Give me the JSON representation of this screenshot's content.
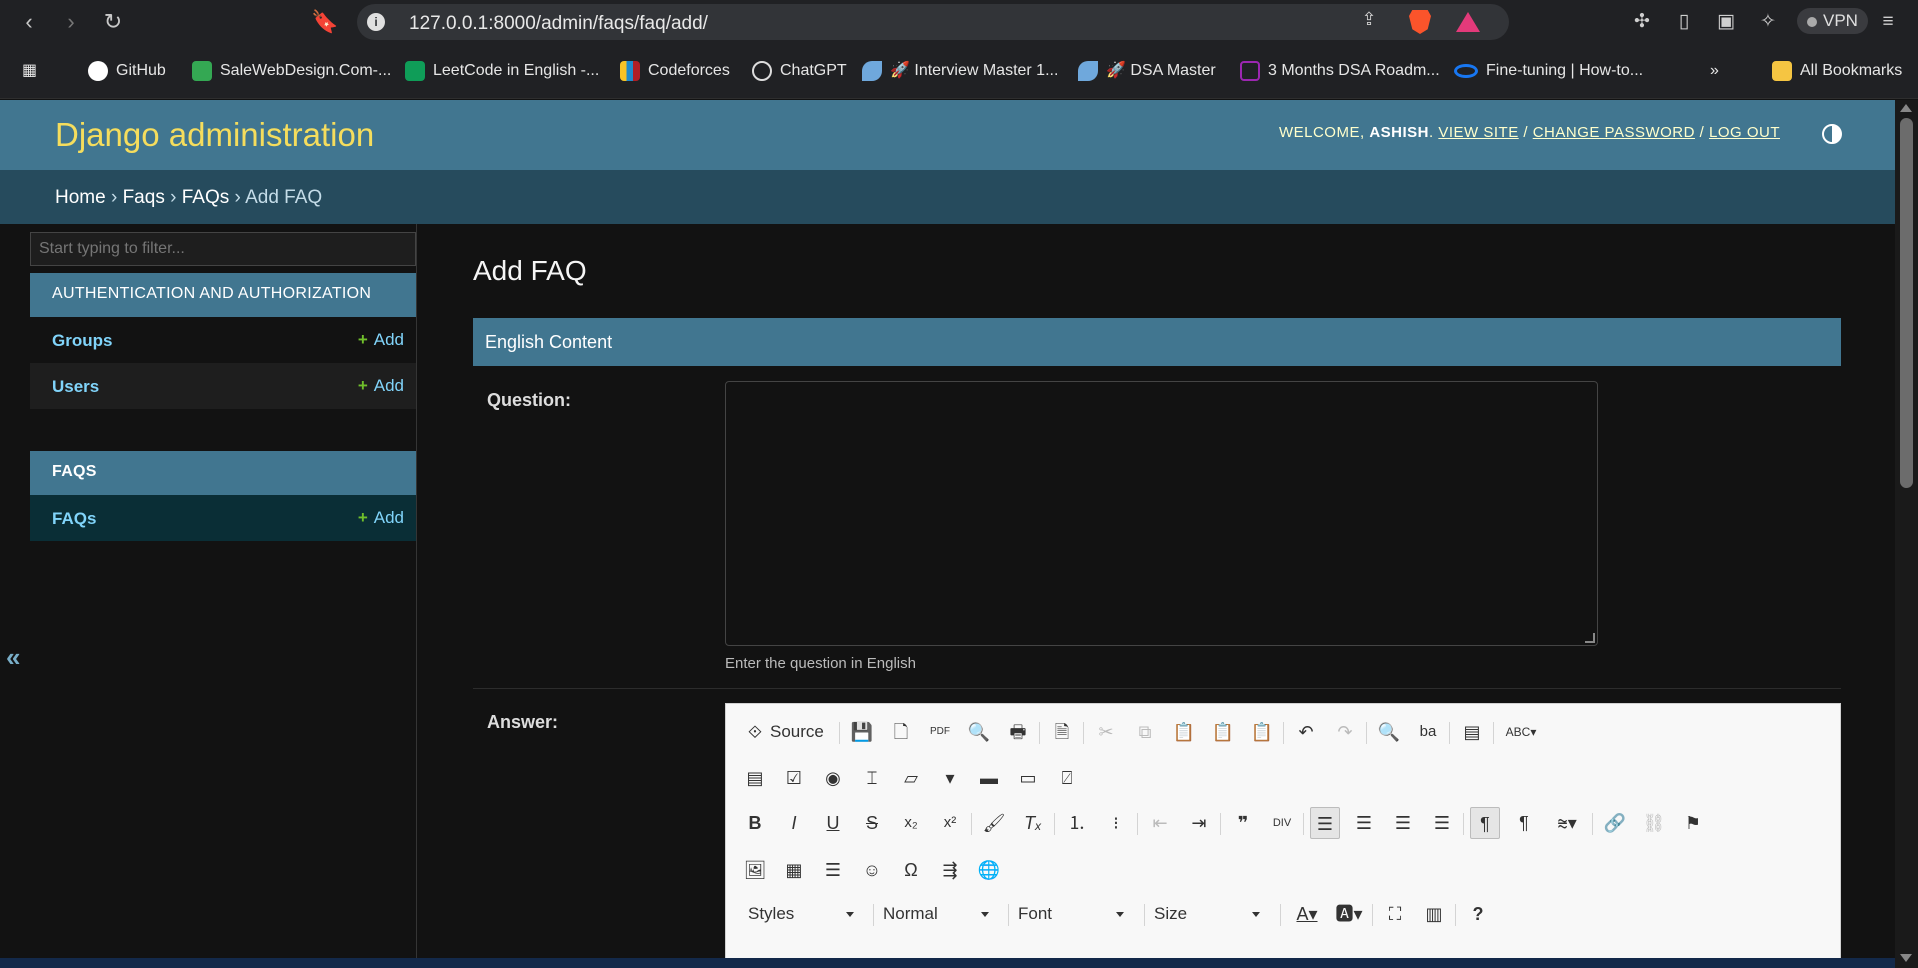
{
  "browser": {
    "url": "127.0.0.1:8000/admin/faqs/faq/add/",
    "vpn_label": "VPN"
  },
  "bookmarks": [
    {
      "label": "GitHub",
      "icon": "github-icon",
      "color": "#ffffff"
    },
    {
      "label": "SaleWebDesign.Com-...",
      "icon": "drive-icon",
      "color": "#34a853"
    },
    {
      "label": "LeetCode in English -...",
      "icon": "sheets-icon",
      "color": "#0f9d58"
    },
    {
      "label": "Codeforces",
      "icon": "codeforces-icon",
      "color": "#1f8acb"
    },
    {
      "label": "ChatGPT",
      "icon": "chatgpt-icon",
      "color": "#ffffff"
    },
    {
      "label": "🚀 Interview Master 1...",
      "icon": "rocket-icon",
      "color": "#6fa8dc"
    },
    {
      "label": "🚀 DSA Master",
      "icon": "rocket-icon",
      "color": "#6fa8dc"
    },
    {
      "label": "3 Months DSA Roadm...",
      "icon": "monitor-icon",
      "color": "#9c27b0"
    },
    {
      "label": "Fine-tuning | How-to...",
      "icon": "meta-icon",
      "color": "#1877f2"
    }
  ],
  "all_bookmarks_label": "All Bookmarks",
  "header": {
    "brand": "Django administration",
    "welcome": "WELCOME,",
    "username": "ASHISH",
    "view_site": "VIEW SITE",
    "change_password": "CHANGE PASSWORD",
    "log_out": "LOG OUT",
    "sep": "/"
  },
  "breadcrumbs": {
    "home": "Home",
    "app": "Faqs",
    "model": "FAQs",
    "current": "Add FAQ",
    "sep": "›"
  },
  "sidebar": {
    "filter_placeholder": "Start typing to filter...",
    "auth_caption": "AUTHENTICATION AND AUTHORIZATION",
    "groups": "Groups",
    "users": "Users",
    "faqs_caption": "FAQS",
    "faqs": "FAQs",
    "add": "Add",
    "plus": "+",
    "collapse": "«"
  },
  "main": {
    "title": "Add FAQ",
    "fieldset": "English Content",
    "question_label": "Question:",
    "question_help": "Enter the question in English",
    "answer_label": "Answer:"
  },
  "editor": {
    "source_label": "Source",
    "styles": "Styles",
    "format": "Normal",
    "font": "Font",
    "size": "Size"
  }
}
